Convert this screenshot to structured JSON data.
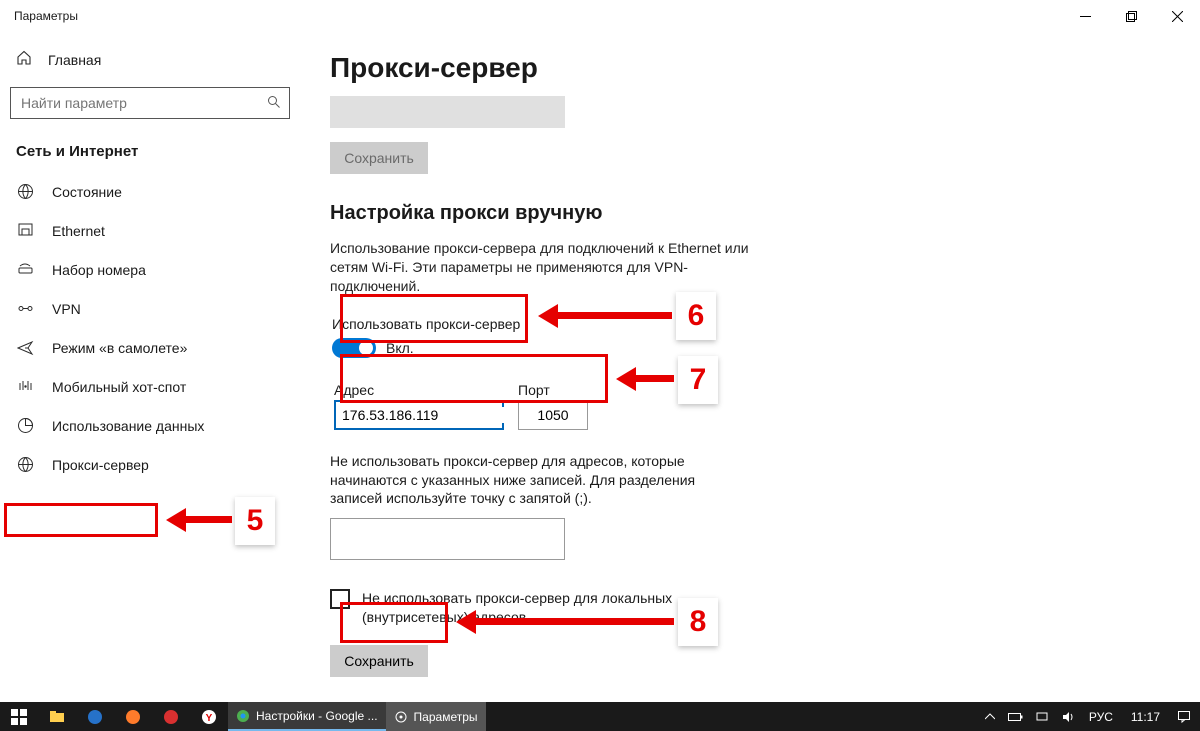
{
  "titlebar": {
    "title": "Параметры"
  },
  "sidebar": {
    "home": "Главная",
    "search_placeholder": "Найти параметр",
    "section": "Сеть и Интернет",
    "items": [
      {
        "label": "Состояние"
      },
      {
        "label": "Ethernet"
      },
      {
        "label": "Набор номера"
      },
      {
        "label": "VPN"
      },
      {
        "label": "Режим «в самолете»"
      },
      {
        "label": "Мобильный хот-спот"
      },
      {
        "label": "Использование данных"
      },
      {
        "label": "Прокси-сервер"
      }
    ]
  },
  "main": {
    "title": "Прокси-сервер",
    "save_disabled": "Сохранить",
    "section_title": "Настройка прокси вручную",
    "description": "Использование прокси-сервера для подключений к Ethernet или сетям Wi-Fi. Эти параметры не применяются для VPN-подключений.",
    "toggle_label": "Использовать прокси-сервер",
    "toggle_state": "Вкл.",
    "address_label": "Адрес",
    "address_value": "176.53.186.119",
    "port_label": "Порт",
    "port_value": "1050",
    "bypass_text": "Не использовать прокси-сервер для адресов, которые начинаются с указанных ниже записей. Для разделения записей используйте точку с запятой (;).",
    "local_bypass": "Не использовать прокси-сервер для локальных (внутрисетевых) адресов",
    "save_btn": "Сохранить"
  },
  "annotations": {
    "n5": "5",
    "n6": "6",
    "n7": "7",
    "n8": "8"
  },
  "taskbar": {
    "app1": "Настройки - Google ...",
    "app2": "Параметры",
    "lang": "РУС",
    "time": "11:17"
  }
}
